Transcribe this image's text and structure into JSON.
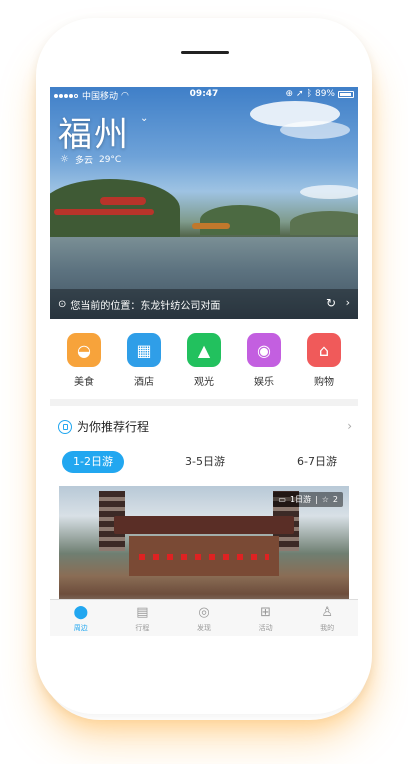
{
  "status_bar": {
    "carrier": "中国移动",
    "time": "09:47",
    "battery": "89%"
  },
  "hero": {
    "city": "福州",
    "weather_condition": "多云",
    "temperature": "29°C",
    "location_text": "您当前的位置：东龙针纺公司对面"
  },
  "categories": [
    {
      "label": "美食",
      "icon": "food-cloche-icon",
      "color": "#f7a33b"
    },
    {
      "label": "酒店",
      "icon": "hotel-building-icon",
      "color": "#2f9ee8"
    },
    {
      "label": "观光",
      "icon": "mountain-icon",
      "color": "#22c15e"
    },
    {
      "label": "娱乐",
      "icon": "music-disc-icon",
      "color": "#c35fe0"
    },
    {
      "label": "购物",
      "icon": "shop-icon",
      "color": "#f05a5a"
    }
  ],
  "recommend": {
    "title": "为你推荐行程",
    "tabs": [
      "1-2日游",
      "3-5日游",
      "6-7日游"
    ],
    "active_tab": 0,
    "trip_card": {
      "duration": "1日游",
      "separator": "|",
      "likes": "2"
    }
  },
  "tab_bar": {
    "items": [
      "周边",
      "行程",
      "发现",
      "活动",
      "我的"
    ],
    "active": 0
  },
  "colors": {
    "accent": "#22a7f0"
  }
}
